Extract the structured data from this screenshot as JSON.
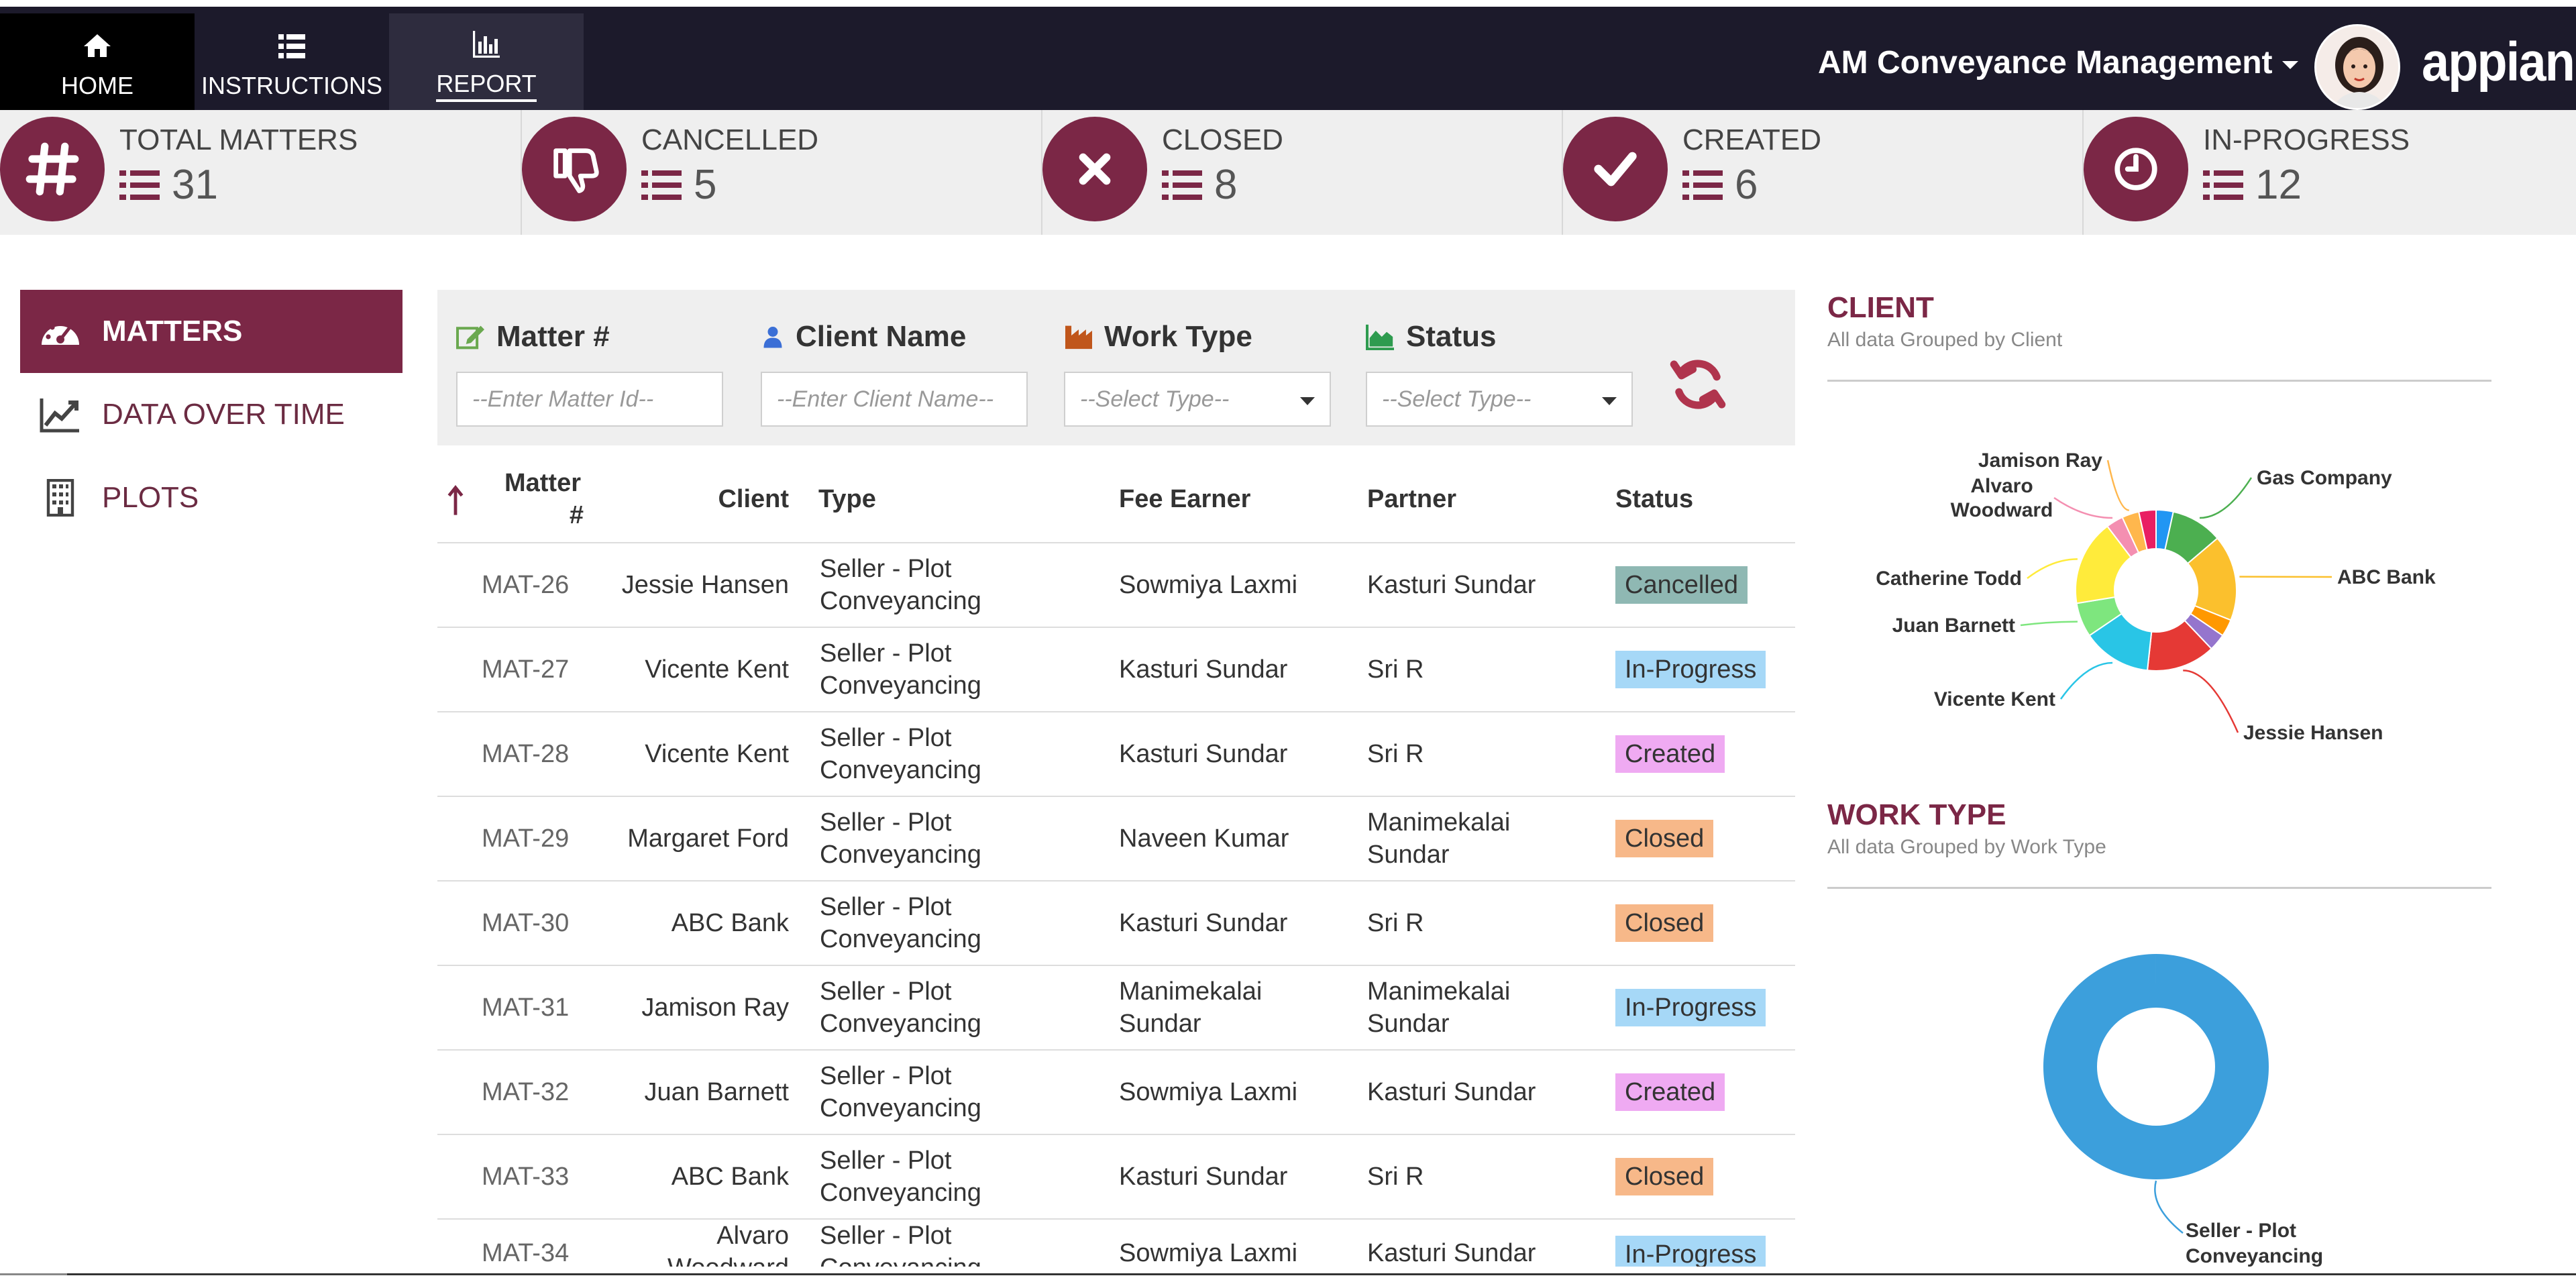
{
  "header": {
    "tabs": [
      {
        "label": "HOME",
        "icon": "home-icon"
      },
      {
        "label": "INSTRUCTIONS",
        "icon": "list-icon"
      },
      {
        "label": "REPORT",
        "icon": "bar-chart-icon"
      }
    ],
    "app_title": "AM Conveyance Management",
    "logo": "appian"
  },
  "kpis": [
    {
      "label": "TOTAL MATTERS",
      "value": "31",
      "icon": "hash-icon"
    },
    {
      "label": "CANCELLED",
      "value": "5",
      "icon": "thumbs-down-icon"
    },
    {
      "label": "CLOSED",
      "value": "8",
      "icon": "close-icon"
    },
    {
      "label": "CREATED",
      "value": "6",
      "icon": "check-icon"
    },
    {
      "label": "IN-PROGRESS",
      "value": "12",
      "icon": "clock-icon"
    }
  ],
  "menu": [
    {
      "label": "MATTERS",
      "icon": "dashboard-icon",
      "active": true
    },
    {
      "label": "DATA OVER TIME",
      "icon": "line-chart-icon",
      "active": false
    },
    {
      "label": "PLOTS",
      "icon": "building-icon",
      "active": false
    }
  ],
  "filters": {
    "matter": {
      "label": "Matter #",
      "placeholder": "--Enter Matter Id--"
    },
    "client": {
      "label": "Client Name",
      "placeholder": "--Enter Client Name--"
    },
    "work_type": {
      "label": "Work Type",
      "placeholder": "--Select Type--"
    },
    "status": {
      "label": "Status",
      "placeholder": "--Select Type--"
    }
  },
  "table": {
    "headers": {
      "matter_line1": "Matter",
      "matter_line2": "#",
      "client": "Client",
      "type": "Type",
      "fee_earner": "Fee Earner",
      "partner": "Partner",
      "status": "Status"
    },
    "rows": [
      {
        "id": "MAT-26",
        "client": "Jessie Hansen",
        "type": "Seller - Plot Conveyancing",
        "fee_earner": "Sowmiya Laxmi",
        "partner": "Kasturi Sundar",
        "status": "Cancelled"
      },
      {
        "id": "MAT-27",
        "client": "Vicente Kent",
        "type": "Seller - Plot Conveyancing",
        "fee_earner": "Kasturi Sundar",
        "partner": "Sri R",
        "status": "In-Progress"
      },
      {
        "id": "MAT-28",
        "client": "Vicente Kent",
        "type": "Seller - Plot Conveyancing",
        "fee_earner": "Kasturi Sundar",
        "partner": "Sri R",
        "status": "Created"
      },
      {
        "id": "MAT-29",
        "client": "Margaret Ford",
        "type": "Seller - Plot Conveyancing",
        "fee_earner": "Naveen Kumar",
        "partner": "Manimekalai Sundar",
        "status": "Closed"
      },
      {
        "id": "MAT-30",
        "client": "ABC Bank",
        "type": "Seller - Plot Conveyancing",
        "fee_earner": "Kasturi Sundar",
        "partner": "Sri R",
        "status": "Closed"
      },
      {
        "id": "MAT-31",
        "client": "Jamison Ray",
        "type": "Seller - Plot Conveyancing",
        "fee_earner": "Manimekalai Sundar",
        "partner": "Manimekalai Sundar",
        "status": "In-Progress"
      },
      {
        "id": "MAT-32",
        "client": "Juan Barnett",
        "type": "Seller - Plot Conveyancing",
        "fee_earner": "Sowmiya Laxmi",
        "partner": "Kasturi Sundar",
        "status": "Created"
      },
      {
        "id": "MAT-33",
        "client": "ABC Bank",
        "type": "Seller - Plot Conveyancing",
        "fee_earner": "Kasturi Sundar",
        "partner": "Sri R",
        "status": "Closed"
      },
      {
        "id": "MAT-34",
        "client": "Alvaro Woodward",
        "type": "Seller - Plot Conveyancing",
        "fee_earner": "Sowmiya Laxmi",
        "partner": "Kasturi Sundar",
        "status": "In-Progress"
      }
    ]
  },
  "status_colors": {
    "Cancelled": "#8fb8b3",
    "In-Progress": "#a6d8f7",
    "Created": "#efaaf2",
    "Closed": "#f7b889"
  },
  "colors": {
    "accent": "#7b2746",
    "header_bg": "#1c1a2b"
  },
  "client_chart": {
    "title": "CLIENT",
    "subtitle": "All data Grouped by Client"
  },
  "work_type_chart": {
    "title": "WORK TYPE",
    "subtitle": "All data Grouped by Work Type"
  },
  "chart_data": [
    {
      "type": "pie",
      "title": "CLIENT",
      "subtitle": "All data Grouped by Client",
      "categories": [
        "Gas Company",
        "ABC Bank",
        "Jessie Hansen",
        "Vicente Kent",
        "Juan Barnett",
        "Catherine Todd",
        "Alvaro Woodward",
        "Jamison Ray"
      ],
      "values": [
        3,
        5,
        4,
        4,
        2,
        5,
        1,
        1
      ],
      "colors": [
        "#4caf50",
        "#fbc02d",
        "#e53935",
        "#29c5e6",
        "#7ee67e",
        "#ffeb3b",
        "#f48fb1",
        "#ffb74d"
      ],
      "extra_slices": [
        {
          "value": 1,
          "color": "#2196f3"
        },
        {
          "value": 1,
          "color": "#ff9800"
        },
        {
          "value": 1,
          "color": "#e91e63"
        },
        {
          "value": 1,
          "color": "#9575cd"
        }
      ]
    },
    {
      "type": "pie",
      "title": "WORK TYPE",
      "subtitle": "All data Grouped by Work Type",
      "categories": [
        "Seller - Plot Conveyancing"
      ],
      "values": [
        31
      ],
      "colors": [
        "#3c9fdc"
      ]
    }
  ]
}
